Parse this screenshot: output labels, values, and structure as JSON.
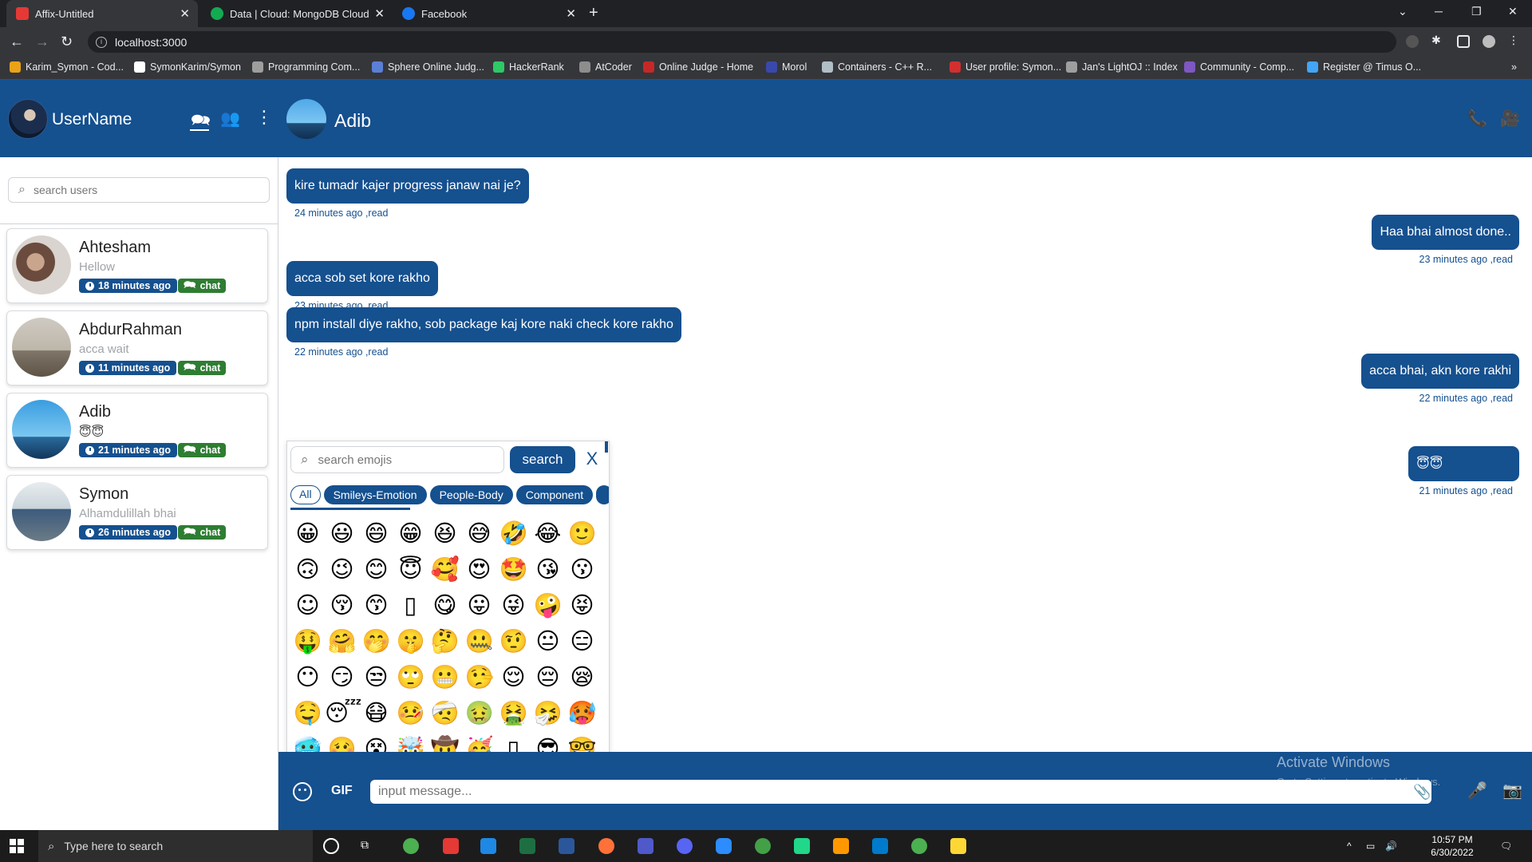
{
  "browser": {
    "tabs": [
      {
        "title": "Affix-Untitled",
        "favicon_color": "#e53935",
        "active": true
      },
      {
        "title": "Data | Cloud: MongoDB Cloud",
        "favicon_color": "#13aa52",
        "active": false
      },
      {
        "title": "Facebook",
        "favicon_color": "#1877f2",
        "active": false
      }
    ],
    "url": "localhost:3000",
    "bookmarks": [
      {
        "label": "Karim_Symon - Cod...",
        "icon_color": "#e8a317"
      },
      {
        "label": "SymonKarim/Symon",
        "icon_color": "#ffffff"
      },
      {
        "label": "Programming Com...",
        "icon_color": "#9e9e9e"
      },
      {
        "label": "Sphere Online Judg...",
        "icon_color": "#5b7fd6"
      },
      {
        "label": "HackerRank",
        "icon_color": "#2ec866"
      },
      {
        "label": "AtCoder",
        "icon_color": "#8d8d8d"
      },
      {
        "label": "Online Judge - Home",
        "icon_color": "#c62828"
      },
      {
        "label": "Morol",
        "icon_color": "#3949ab"
      },
      {
        "label": "Containers - C++ R...",
        "icon_color": "#b0bec5"
      },
      {
        "label": "User profile: Symon...",
        "icon_color": "#d32f2f"
      },
      {
        "label": "Jan's LightOJ :: Index",
        "icon_color": "#9e9e9e"
      },
      {
        "label": "Community - Comp...",
        "icon_color": "#7e57c2"
      },
      {
        "label": "Register @ Timus O...",
        "icon_color": "#42a5f5"
      }
    ]
  },
  "sidebar": {
    "username": "UserName",
    "search_placeholder": "search users",
    "contacts": [
      {
        "name": "Ahtesham",
        "last": "Hellow",
        "time": "18 minutes ago",
        "chat": "chat"
      },
      {
        "name": "AbdurRahman",
        "last": "acca wait",
        "time": "11 minutes ago",
        "chat": "chat"
      },
      {
        "name": "Adib",
        "last": "😇😇",
        "time": "21 minutes ago",
        "chat": "chat"
      },
      {
        "name": "Symon",
        "last": "Alhamdulillah bhai",
        "time": "26 minutes ago",
        "chat": "chat"
      }
    ]
  },
  "chat": {
    "peer_name": "Adib",
    "messages": [
      {
        "text": "kire tumadr kajer progress janaw nai je?",
        "meta": "24 minutes ago ,read",
        "side": "in"
      },
      {
        "text": "Haa bhai almost done..",
        "meta": "23 minutes ago ,read",
        "side": "out"
      },
      {
        "text": "acca sob set kore rakho",
        "meta": "23 minutes ago ,read",
        "side": "in"
      },
      {
        "text": "npm install diye rakho, sob package kaj kore naki check kore rakho",
        "meta": "22 minutes ago ,read",
        "side": "in"
      },
      {
        "text": "acca bhai, akn kore rakhi",
        "meta": "22 minutes ago ,read",
        "side": "out"
      },
      {
        "text": "😇😇",
        "meta": "21 minutes ago ,read",
        "side": "out"
      }
    ],
    "composer": {
      "gif_label": "GIF",
      "placeholder": "input message..."
    }
  },
  "emoji_picker": {
    "search_placeholder": "search emojis",
    "search_button": "search",
    "close": "X",
    "categories": [
      "All",
      "Smileys-Emotion",
      "People-Body",
      "Component"
    ],
    "emojis": [
      "😀",
      "😃",
      "😄",
      "😁",
      "😆",
      "😅",
      "🤣",
      "😂",
      "🙂",
      "🙃",
      "😉",
      "😊",
      "😇",
      "🥰",
      "😍",
      "🤩",
      "😘",
      "😗",
      "☺",
      "😚",
      "😙",
      "▯",
      "😋",
      "😛",
      "😜",
      "🤪",
      "😝",
      "🤑",
      "🤗",
      "🤭",
      "🤫",
      "🤔",
      "🤐",
      "🤨",
      "😐",
      "😑",
      "😶",
      "😏",
      "😒",
      "🙄",
      "😬",
      "🤥",
      "😌",
      "😔",
      "😪",
      "🤤",
      "😴",
      "😷",
      "🤒",
      "🤕",
      "🤢",
      "🤮",
      "🤧",
      "🥵",
      "🥶",
      "🥴",
      "😵",
      "🤯",
      "🤠",
      "🥳",
      "▯",
      "😎",
      "🤓"
    ]
  },
  "watermark": {
    "title": "Activate Windows",
    "subtitle": "Go to Settings to activate Windows."
  },
  "taskbar": {
    "search_placeholder": "Type here to search",
    "time": "10:57 PM",
    "date": "6/30/2022"
  }
}
